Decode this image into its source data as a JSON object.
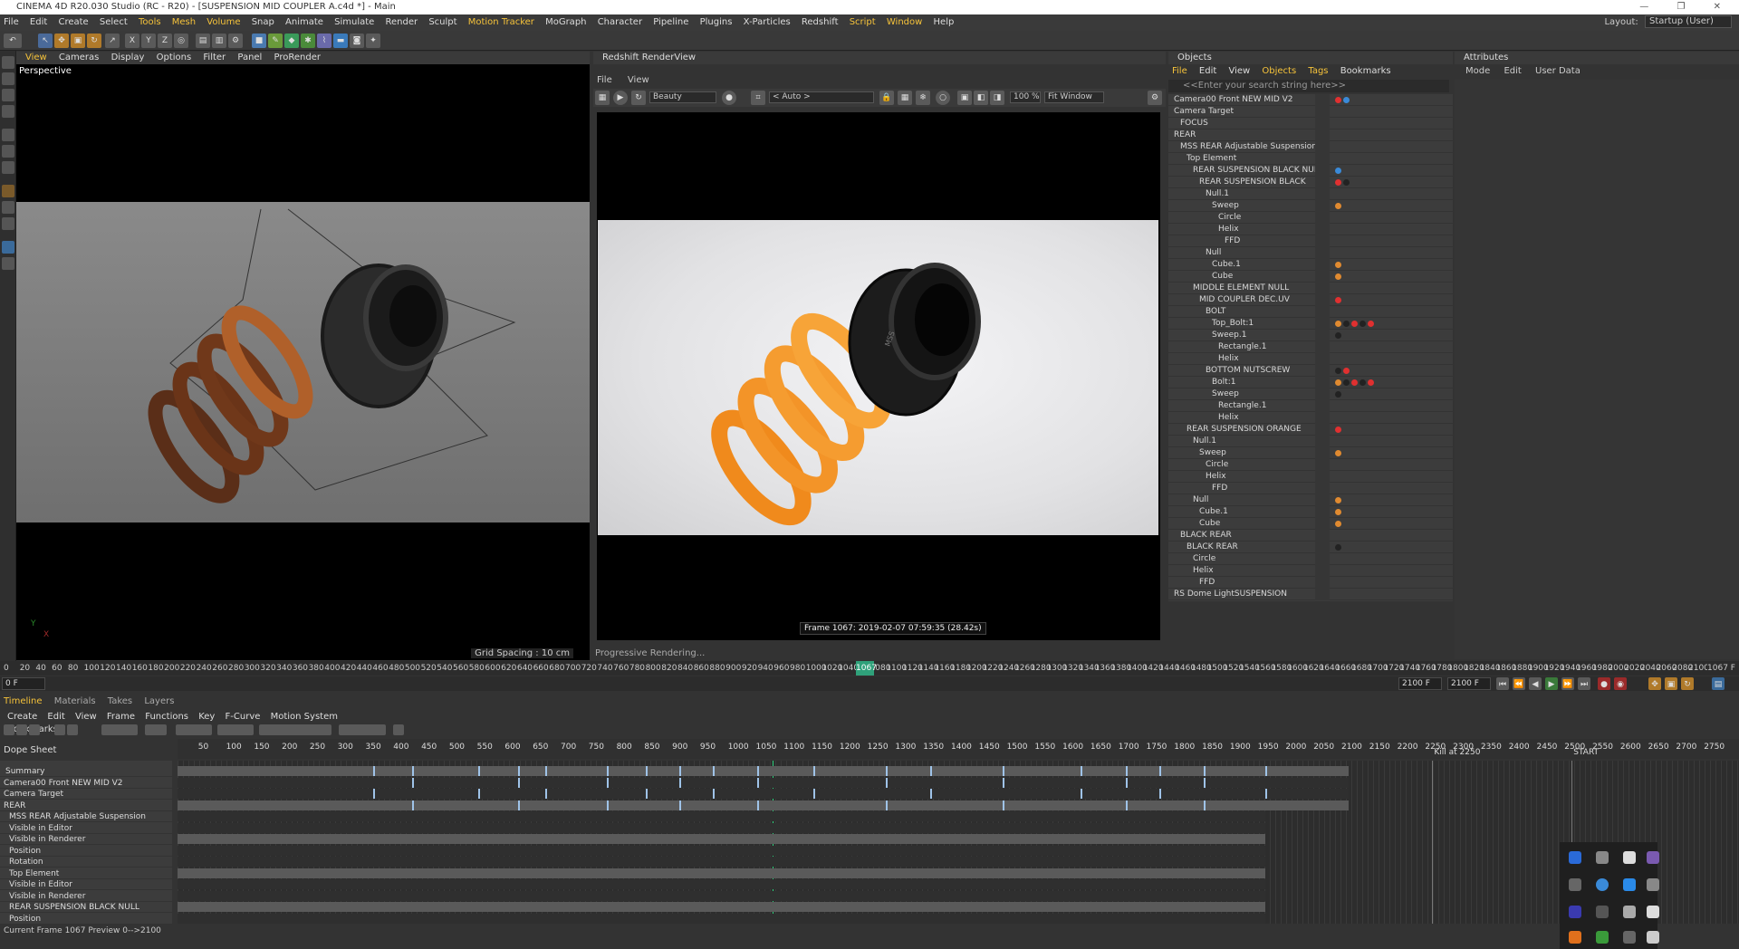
{
  "window": {
    "title": "CINEMA 4D R20.030 Studio (RC - R20) - [SUSPENSION MID COUPLER A.c4d *] - Main"
  },
  "menu": [
    "File",
    "Edit",
    "Create",
    "Select",
    "Tools",
    "Mesh",
    "Volume",
    "Snap",
    "Animate",
    "Simulate",
    "Render",
    "Sculpt",
    "Motion Tracker",
    "MoGraph",
    "Character",
    "Pipeline",
    "Plugins",
    "X-Particles",
    "Redshift",
    "Script",
    "Window",
    "Help"
  ],
  "layout": {
    "label": "Layout:",
    "value": "Startup (User)"
  },
  "viewport": {
    "menu": [
      "View",
      "Cameras",
      "Display",
      "Options",
      "Filter",
      "Panel",
      "ProRender"
    ],
    "label": "Perspective",
    "grid_spacing": "Grid Spacing : 10 cm"
  },
  "renderview": {
    "title": "Redshift RenderView",
    "menu": [
      "File",
      "View"
    ],
    "aov": "Beauty",
    "camera": "< Auto >",
    "zoom": "100 %",
    "fit": "Fit Window",
    "stamp": "Frame 1067:  2019-02-07  07:59:35  (28.42s)",
    "status": "Progressive Rendering...",
    "logo_text": "MSS"
  },
  "objects": {
    "title": "Objects",
    "menu": [
      "File",
      "Edit",
      "View",
      "Objects",
      "Tags",
      "Bookmarks"
    ],
    "search_placeholder": "<<Enter your search string here>>",
    "rows": [
      {
        "name": "Camera00 Front NEW MID V2",
        "indent": 0,
        "tags": [
          "#e03030",
          "#3a8ad8"
        ]
      },
      {
        "name": "Camera Target",
        "indent": 0,
        "tags": []
      },
      {
        "name": "FOCUS",
        "indent": 1,
        "tags": []
      },
      {
        "name": "REAR",
        "indent": 0,
        "tags": []
      },
      {
        "name": "MSS REAR Adjustable Suspension",
        "indent": 1,
        "tags": []
      },
      {
        "name": "Top Element",
        "indent": 2,
        "tags": []
      },
      {
        "name": "REAR SUSPENSION BLACK NULL",
        "indent": 3,
        "tags": [
          "#3a8ad8"
        ]
      },
      {
        "name": "REAR SUSPENSION BLACK",
        "indent": 4,
        "tags": [
          "#e03030",
          "#222222"
        ]
      },
      {
        "name": "Null.1",
        "indent": 5,
        "tags": []
      },
      {
        "name": "Sweep",
        "indent": 6,
        "tags": [
          "#e08a30"
        ]
      },
      {
        "name": "Circle",
        "indent": 7,
        "tags": []
      },
      {
        "name": "Helix",
        "indent": 7,
        "tags": []
      },
      {
        "name": "FFD",
        "indent": 8,
        "tags": []
      },
      {
        "name": "Null",
        "indent": 5,
        "tags": []
      },
      {
        "name": "Cube.1",
        "indent": 6,
        "tags": [
          "#e08a30"
        ]
      },
      {
        "name": "Cube",
        "indent": 6,
        "tags": [
          "#e08a30"
        ]
      },
      {
        "name": "MIDDLE ELEMENT NULL",
        "indent": 3,
        "tags": []
      },
      {
        "name": "MID COUPLER DEC.UV",
        "indent": 4,
        "tags": [
          "#e03030"
        ]
      },
      {
        "name": "BOLT",
        "indent": 5,
        "tags": []
      },
      {
        "name": "Top_Bolt:1",
        "indent": 6,
        "tags": [
          "#e08a30",
          "#222222",
          "#e03030",
          "#222222",
          "#e03030"
        ]
      },
      {
        "name": "Sweep.1",
        "indent": 6,
        "tags": [
          "#222222"
        ]
      },
      {
        "name": "Rectangle.1",
        "indent": 7,
        "tags": []
      },
      {
        "name": "Helix",
        "indent": 7,
        "tags": []
      },
      {
        "name": "BOTTOM NUTSCREW",
        "indent": 5,
        "tags": [
          "#222222",
          "#e03030"
        ]
      },
      {
        "name": "Bolt:1",
        "indent": 6,
        "tags": [
          "#e08a30",
          "#222222",
          "#e03030",
          "#222222",
          "#e03030"
        ]
      },
      {
        "name": "Sweep",
        "indent": 6,
        "tags": [
          "#222222"
        ]
      },
      {
        "name": "Rectangle.1",
        "indent": 7,
        "tags": []
      },
      {
        "name": "Helix",
        "indent": 7,
        "tags": []
      },
      {
        "name": "REAR SUSPENSION ORANGE",
        "indent": 2,
        "tags": [
          "#e03030"
        ]
      },
      {
        "name": "Null.1",
        "indent": 3,
        "tags": []
      },
      {
        "name": "Sweep",
        "indent": 4,
        "tags": [
          "#e08a30"
        ]
      },
      {
        "name": "Circle",
        "indent": 5,
        "tags": []
      },
      {
        "name": "Helix",
        "indent": 5,
        "tags": []
      },
      {
        "name": "FFD",
        "indent": 6,
        "tags": []
      },
      {
        "name": "Null",
        "indent": 3,
        "tags": [
          "#e08a30"
        ]
      },
      {
        "name": "Cube.1",
        "indent": 4,
        "tags": [
          "#e08a30"
        ]
      },
      {
        "name": "Cube",
        "indent": 4,
        "tags": [
          "#e08a30"
        ]
      },
      {
        "name": "BLACK REAR",
        "indent": 1,
        "tags": []
      },
      {
        "name": "BLACK REAR",
        "indent": 2,
        "tags": [
          "#222222"
        ]
      },
      {
        "name": "Circle",
        "indent": 3,
        "tags": []
      },
      {
        "name": "Helix",
        "indent": 3,
        "tags": []
      },
      {
        "name": "FFD",
        "indent": 4,
        "tags": []
      },
      {
        "name": "RS Dome LightSUSPENSION",
        "indent": 0,
        "tags": []
      }
    ]
  },
  "attributes": {
    "title": "Attributes",
    "menu": [
      "Mode",
      "Edit",
      "User Data"
    ]
  },
  "ruler": {
    "ticks": [
      "0",
      "20",
      "40",
      "60",
      "80",
      "100",
      "120",
      "140",
      "160",
      "180",
      "200",
      "220",
      "240",
      "260",
      "280",
      "300",
      "320",
      "340",
      "360",
      "380",
      "400",
      "420",
      "440",
      "460",
      "480",
      "500",
      "520",
      "540",
      "560",
      "580",
      "600",
      "620",
      "640",
      "660",
      "680",
      "700",
      "720",
      "740",
      "760",
      "780",
      "800",
      "820",
      "840",
      "860",
      "880",
      "900",
      "920",
      "940",
      "960",
      "980",
      "1000",
      "1020",
      "1040",
      "1060",
      "1080",
      "1100",
      "1120",
      "1140",
      "1160",
      "1180",
      "1200",
      "1220",
      "1240",
      "1260",
      "1280",
      "1300",
      "1320",
      "1340",
      "1360",
      "1380",
      "1400",
      "1420",
      "1440",
      "1460",
      "1480",
      "1500",
      "1520",
      "1540",
      "1560",
      "1580",
      "1600",
      "1620",
      "1640",
      "1660",
      "1680",
      "1700",
      "1720",
      "1740",
      "1760",
      "1780",
      "1800",
      "1820",
      "1840",
      "1860",
      "1880",
      "1900",
      "1920",
      "1940",
      "1960",
      "1980",
      "2000",
      "2020",
      "2040",
      "2060",
      "2080",
      "2100"
    ],
    "current": "1067",
    "current_label": "1067 F"
  },
  "framebar": {
    "start": "0 F",
    "end_a": "2100 F",
    "end_b": "2100 F"
  },
  "timeline": {
    "tabs": [
      "Timeline",
      "Materials",
      "Takes",
      "Layers"
    ],
    "menu": [
      "Create",
      "Edit",
      "View",
      "Frame",
      "Functions",
      "Key",
      "F-Curve",
      "Motion System",
      "Bookmarks"
    ],
    "title": "Dope Sheet",
    "ruler_ticks": [
      "50",
      "100",
      "150",
      "200",
      "250",
      "300",
      "350",
      "400",
      "450",
      "500",
      "550",
      "600",
      "650",
      "700",
      "750",
      "800",
      "850",
      "900",
      "950",
      "1000",
      "1050",
      "1100",
      "1150",
      "1200",
      "1250",
      "1300",
      "1350",
      "1400",
      "1450",
      "1500",
      "1550",
      "1600",
      "1650",
      "1700",
      "1750",
      "1800",
      "1850",
      "1900",
      "1950",
      "2000",
      "2050",
      "2100",
      "2150",
      "2200",
      "2250",
      "2300",
      "2350",
      "2400",
      "2450",
      "2500",
      "2550",
      "2600",
      "2650",
      "2700",
      "2750"
    ],
    "cursor": "1067",
    "marker_kill": "Kill at 2250",
    "marker_start": "START",
    "rows": [
      "Summary",
      "Camera00 Front NEW MID V2",
      "Camera Target",
      "REAR",
      "MSS REAR Adjustable Suspension",
      "Visible in Editor",
      "Visible in Renderer",
      "Position",
      "Rotation",
      "Top Element",
      "Visible in Editor",
      "Visible in Renderer",
      "REAR SUSPENSION BLACK NULL",
      "Position"
    ]
  },
  "statusbar": {
    "text": "Current Frame  1067  Preview  0-->2100"
  }
}
